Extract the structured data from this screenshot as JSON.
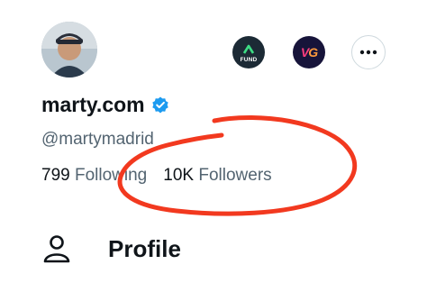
{
  "profile": {
    "display_name": "marty.com",
    "handle": "@martymadrid",
    "verified": true
  },
  "actions": {
    "fund_label": "FUND",
    "vg_label_v": "V",
    "vg_label_g": "G"
  },
  "stats": {
    "following_count": "799",
    "following_label": "Following",
    "followers_count": "10K",
    "followers_label": "Followers"
  },
  "menu": {
    "profile_label": "Profile"
  },
  "colors": {
    "verified_blue": "#1d9bf0",
    "annotation_red": "#f2391f",
    "secondary_text": "#536471"
  }
}
